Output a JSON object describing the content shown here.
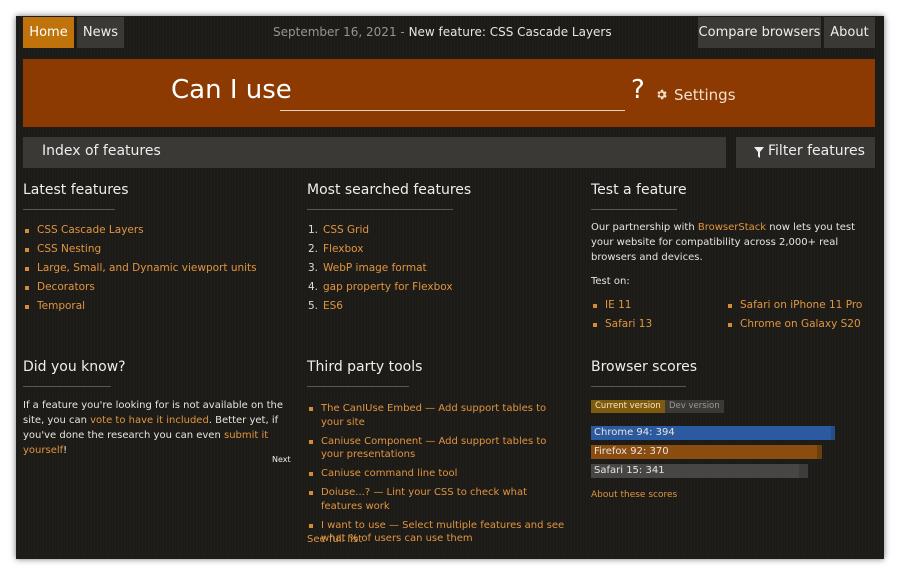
{
  "nav": {
    "home": "Home",
    "news": "News",
    "announce_date": "September 16, 2021",
    "announce_sep": " - ",
    "announce_text": "New feature: CSS Cascade Layers",
    "compare": "Compare browsers",
    "about": "About"
  },
  "hero": {
    "label": "Can I use",
    "question": "?",
    "settings": "Settings",
    "search_value": ""
  },
  "index": {
    "label": "Index of features",
    "filter": "Filter features"
  },
  "latest": {
    "title": "Latest features",
    "items": [
      "CSS Cascade Layers",
      "CSS Nesting",
      "Large, Small, and Dynamic viewport units",
      "Decorators",
      "Temporal"
    ]
  },
  "most_searched": {
    "title": "Most searched features",
    "items": [
      "CSS Grid",
      "Flexbox",
      "WebP image format",
      "gap property for Flexbox",
      "ES6"
    ]
  },
  "test": {
    "title": "Test a feature",
    "text1": "Our partnership with ",
    "link": "BrowserStack",
    "text2": " now lets you test your website for compatibility across 2,000+ real browsers and devices.",
    "test_on": "Test on:",
    "left": [
      "IE 11",
      "Safari 13"
    ],
    "right": [
      "Safari on iPhone 11 Pro",
      "Chrome on Galaxy S20"
    ]
  },
  "did_you_know": {
    "title": "Did you know?",
    "t1": "If a feature you're looking for is not available on the site, you can ",
    "l1": "vote to have it included",
    "t2": ". Better yet, if you've done the research you can even ",
    "l2": "submit it yourself",
    "t3": "!",
    "next": "Next"
  },
  "tools": {
    "title": "Third party tools",
    "items": [
      "The CanIUse Embed — Add support tables to your site",
      "Caniuse Component — Add support tables to your presentations",
      "Caniuse command line tool",
      "Doiuse...? — Lint your CSS to check what features work",
      "I want to use — Select multiple features and see what % of users can use them"
    ],
    "see_full": "See full list"
  },
  "scores": {
    "title": "Browser scores",
    "tab_current": "Current version",
    "tab_dev": "Dev version",
    "max": 400,
    "bars": [
      {
        "label": "Chrome 94: 394",
        "value": 394,
        "upcoming": 400,
        "color": "#2b5aa0",
        "ghost": "#274d86"
      },
      {
        "label": "Firefox 92: 370",
        "value": 370,
        "upcoming": 378,
        "color": "#8b4c0f",
        "ghost": "#6e3d0e"
      },
      {
        "label": "Safari 15: 341",
        "value": 341,
        "upcoming": 356,
        "color": "#474644",
        "ghost": "#3d3c3a"
      }
    ],
    "about": "About these scores"
  },
  "colors": {
    "accent": "#c0730b",
    "hero": "#8c3a02",
    "link": "#e0953f"
  }
}
